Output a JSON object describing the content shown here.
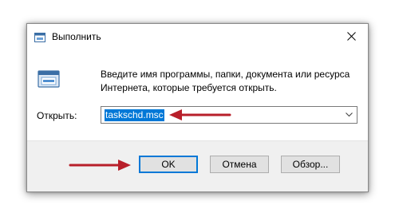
{
  "window": {
    "title": "Выполнить"
  },
  "description": "Введите имя программы, папки, документа или ресурса Интернета, которые требуется открыть.",
  "open_field": {
    "label": "Открыть:",
    "value": "taskschd.msc"
  },
  "buttons": {
    "ok": "OK",
    "cancel": "Отмена",
    "browse": "Обзор..."
  },
  "colors": {
    "accent": "#0078d7",
    "annotation": "#c0222b",
    "footer_bg": "#f0f0f0"
  },
  "icons": {
    "title": "run-dialog-icon",
    "close": "close-icon",
    "program": "run-program-icon",
    "dropdown": "chevron-down-icon"
  }
}
